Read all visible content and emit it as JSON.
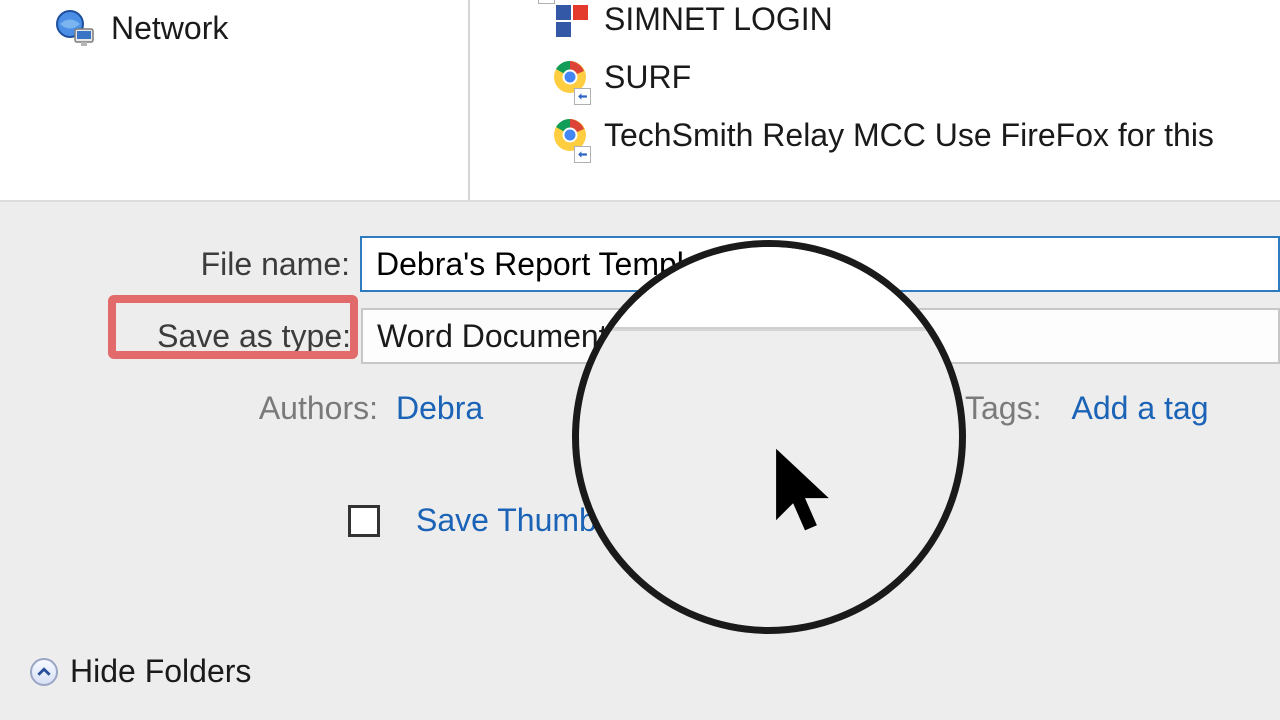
{
  "nav": {
    "network_label": "Network"
  },
  "files": {
    "items": [
      {
        "name": "SIMNET LOGIN",
        "icon": "simnet"
      },
      {
        "name": "SURF",
        "icon": "chrome"
      },
      {
        "name": "TechSmith Relay MCC Use FireFox for this",
        "icon": "chrome"
      }
    ]
  },
  "form": {
    "filename_label": "File name:",
    "filename_value": "Debra's Report Template",
    "savetype_label": "Save as type:",
    "savetype_value": "Word Document",
    "authors_label": "Authors:",
    "authors_value": "Debra",
    "tags_label": "Tags:",
    "tags_value": "Add a tag",
    "thumbnail_label": "Save Thumbnail"
  },
  "footer": {
    "hide_folders": "Hide Folders"
  }
}
